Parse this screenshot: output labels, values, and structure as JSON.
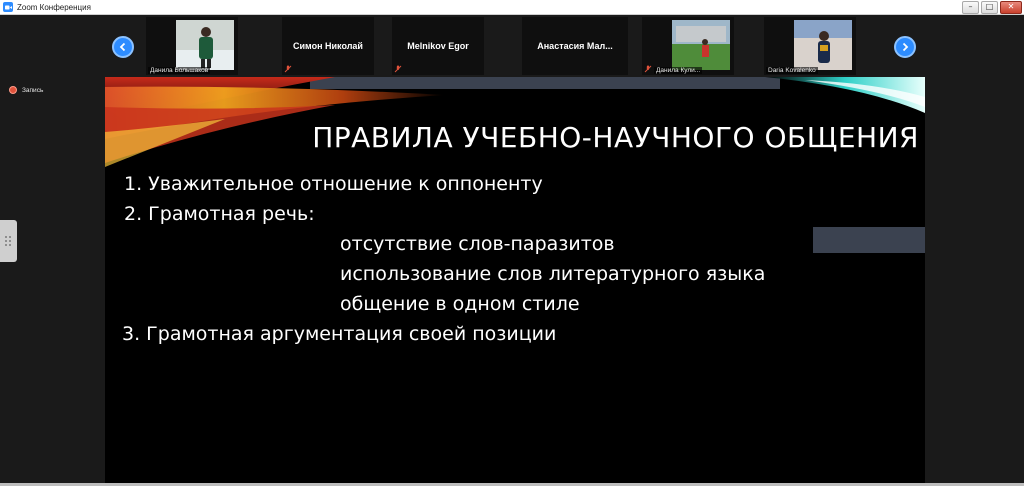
{
  "window": {
    "title": "Zoom Конференция",
    "controls": {
      "minimize": "–",
      "maximize": "□",
      "close": "✕"
    }
  },
  "participants": [
    {
      "name": "Данила Большаков",
      "has_video": true,
      "muted": false,
      "photo_bg": "#5a8a6a"
    },
    {
      "name": "Симон Николай",
      "has_video": false,
      "muted": true
    },
    {
      "name": "Melnikov Egor",
      "has_video": false,
      "muted": true
    },
    {
      "name": "Анастасия  Мал...",
      "has_video": false,
      "muted": false
    },
    {
      "name": "Данила Кули...",
      "has_video": true,
      "muted": true,
      "photo_bg": "#4f8c3a"
    },
    {
      "name": "Daria Kovalenko",
      "has_video": true,
      "muted": false,
      "photo_bg": "#8aa4c8"
    }
  ],
  "recording": {
    "label": "Запись"
  },
  "slide": {
    "title": "ПРАВИЛА УЧЕБНО-НАУЧНОГО ОБЩЕНИЯ",
    "lines": [
      "1.  Уважительное отношение к оппоненту",
      "2.  Грамотная речь:",
      "отсутствие слов-паразитов",
      "использование слов литературного языка",
      "общение в одном стиле",
      "3. Грамотная аргументация своей позиции"
    ]
  },
  "colors": {
    "accent": "#2d8cff",
    "muted_icon": "#e0533c"
  }
}
